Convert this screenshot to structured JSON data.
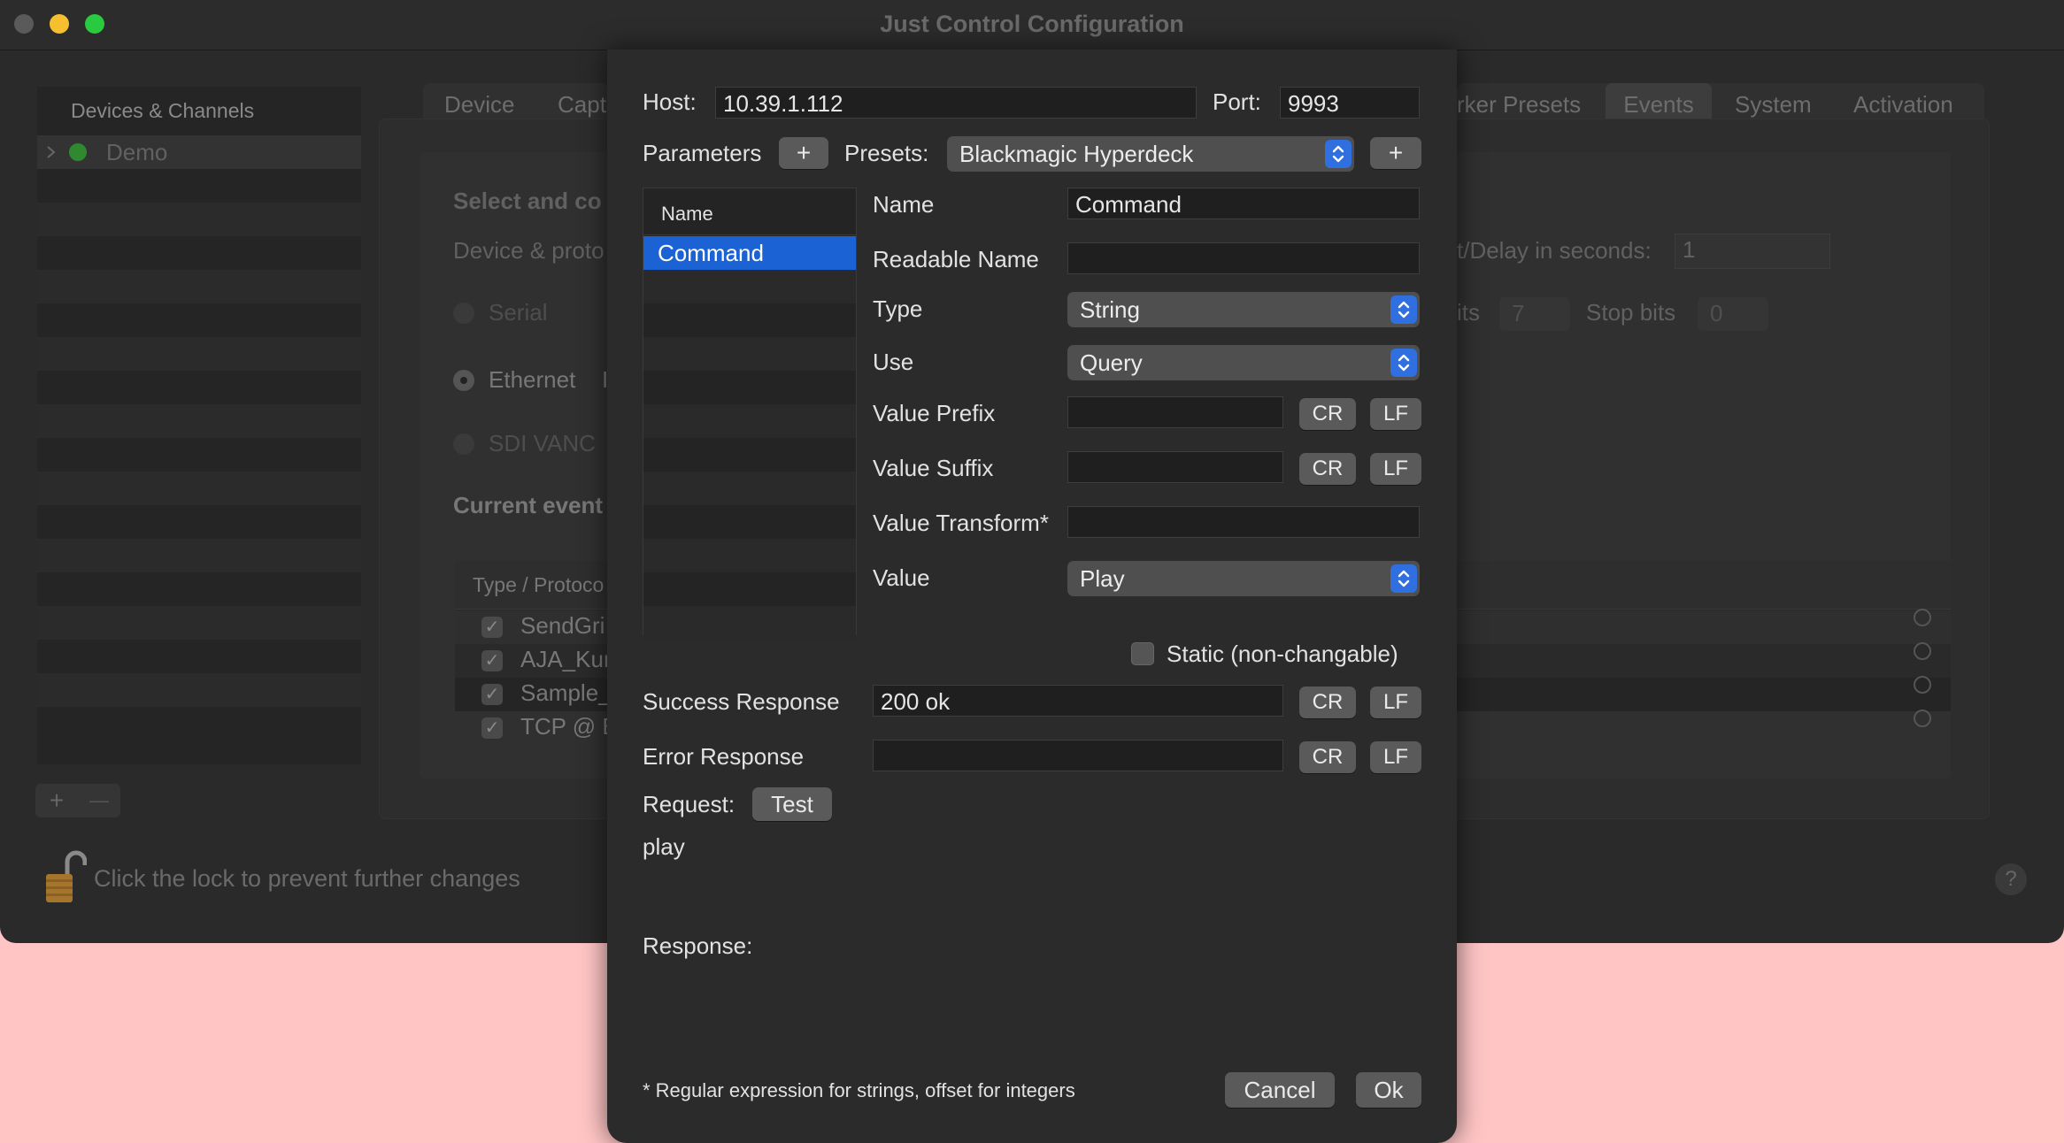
{
  "window": {
    "title": "Just Control Configuration",
    "traffic_colors": [
      "#5a5a5a",
      "#f5bf2f",
      "#29c940"
    ]
  },
  "sidebar": {
    "header": "Devices & Channels",
    "items": [
      {
        "label": "Demo",
        "status_color": "#2f8a2f"
      }
    ],
    "add_symbol": "+",
    "remove_symbol": "—"
  },
  "tabs": {
    "visible_left": [
      "Device",
      "Capt"
    ],
    "visible_right": [
      "rker Presets",
      "Events",
      "System",
      "Activation"
    ],
    "active": "Events"
  },
  "background_panel": {
    "heading": "Select and co",
    "device_protocol": "Device & proto",
    "delay_label": "t/Delay in seconds:",
    "delay_value": "1",
    "options": [
      "Serial",
      "Ethernet",
      "SDI VANC"
    ],
    "ethernet_extra": "I",
    "bits_label": "its",
    "bits_value": "7",
    "stop_bits_label": "Stop bits",
    "stop_bits_value": "0",
    "current_events": "Current event",
    "table_header": "Type / Protoco",
    "events": [
      "SendGri",
      "AJA_Kur",
      "Sample_",
      "TCP @ B"
    ]
  },
  "lock_text": "Click the lock to prevent further changes",
  "help_symbol": "?",
  "dialog": {
    "host_label": "Host:",
    "host_value": "10.39.1.112",
    "port_label": "Port:",
    "port_value": "9993",
    "parameters_label": "Parameters",
    "plus": "+",
    "presets_label": "Presets:",
    "preset_value": "Blackmagic Hyperdeck",
    "list_header": "Name",
    "list_items": [
      "Command"
    ],
    "fields": {
      "name_label": "Name",
      "name_value": "Command",
      "readable_label": "Readable Name",
      "readable_value": "",
      "type_label": "Type",
      "type_value": "String",
      "use_label": "Use",
      "use_value": "Query",
      "prefix_label": "Value Prefix",
      "suffix_label": "Value Suffix",
      "transform_label": "Value Transform*",
      "value_label": "Value",
      "value_value": "Play"
    },
    "cr": "CR",
    "lf": "LF",
    "static_label": "Static (non-changable)",
    "success_label": "Success Response",
    "success_value": "200 ok",
    "error_label": "Error Response",
    "error_value": "",
    "request_label": "Request:",
    "test_button": "Test",
    "request_text": "play",
    "response_label": "Response:",
    "footnote": "* Regular expression for strings, offset for integers",
    "cancel": "Cancel",
    "ok": "Ok"
  }
}
